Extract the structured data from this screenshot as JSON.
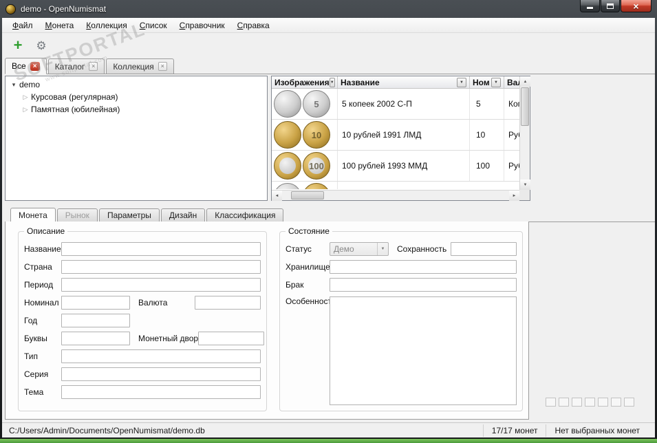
{
  "window": {
    "title": "demo - OpenNumismat"
  },
  "icons": {
    "close": "×",
    "plus": "+",
    "gear": "⚙",
    "filter": "▼",
    "combo": "▼",
    "tree_open": "▾",
    "tree_closed": "▷",
    "up": "▲",
    "down": "▼",
    "left": "◄",
    "right": "►",
    "tab_close": "×"
  },
  "watermark": {
    "title": "SOFTPORTAL",
    "url": "www.softportal.com"
  },
  "menu": {
    "items": [
      "Файл",
      "Монета",
      "Коллекция",
      "Список",
      "Справочник",
      "Справка"
    ]
  },
  "main_tabs": [
    {
      "label": "Все"
    },
    {
      "label": "Каталог"
    },
    {
      "label": "Коллекция"
    }
  ],
  "tree": {
    "root": "demo",
    "children": [
      "Курсовая (регулярная)",
      "Памятная (юбилейная)"
    ]
  },
  "table": {
    "columns": [
      {
        "label": "Изображения"
      },
      {
        "label": "Название"
      },
      {
        "label": "Ном"
      },
      {
        "label": "Вал"
      }
    ],
    "rows": [
      {
        "title": "5 копеек 2002 С-П",
        "nominal": "5",
        "currency": "Коп"
      },
      {
        "title": "10 рублей 1991 ЛМД",
        "nominal": "10",
        "currency": "Руб"
      },
      {
        "title": "100 рублей 1993 ММД",
        "nominal": "100",
        "currency": "Руб"
      }
    ]
  },
  "detail_tabs": [
    "Монета",
    "Рынок",
    "Параметры",
    "Дизайн",
    "Классификация"
  ],
  "form": {
    "description": {
      "title": "Описание",
      "labels": {
        "name": "Название",
        "country": "Страна",
        "period": "Период",
        "nominal": "Номинал",
        "currency": "Валюта",
        "year": "Год",
        "letters": "Буквы",
        "mint": "Монетный двор",
        "type": "Тип",
        "series": "Серия",
        "theme": "Тема"
      }
    },
    "state": {
      "title": "Состояние",
      "labels": {
        "status": "Статус",
        "grade": "Сохранность",
        "storage": "Хранилище",
        "defect": "Брак",
        "features": "Особенности"
      },
      "status_value": "Демо"
    }
  },
  "statusbar": {
    "path": "C:/Users/Admin/Documents/OpenNumismat/demo.db",
    "count": "17/17 монет",
    "selection": "Нет выбранных монет"
  }
}
